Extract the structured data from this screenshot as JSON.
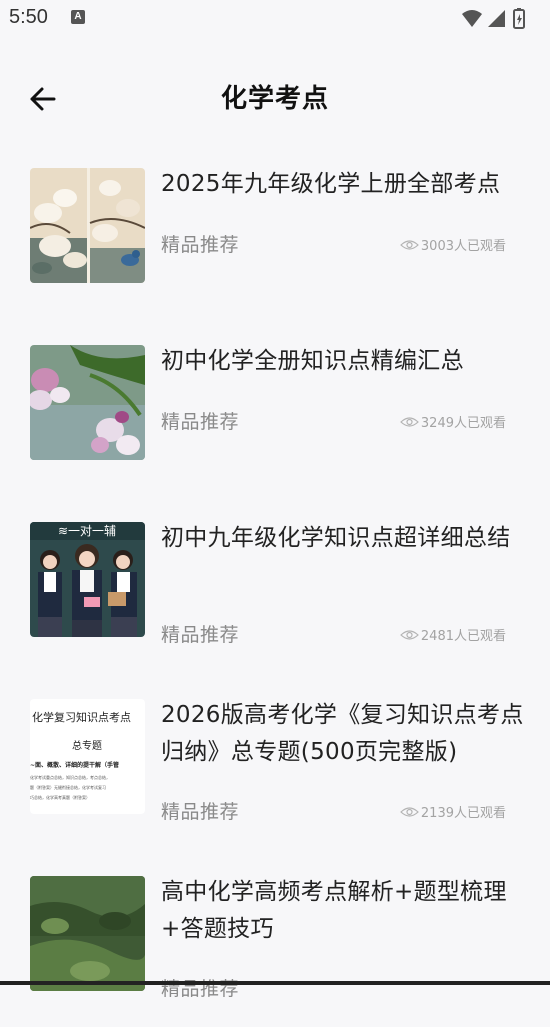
{
  "status_bar": {
    "time": "5:50",
    "a_icon_label": "A"
  },
  "header": {
    "title": "化学考点"
  },
  "items": [
    {
      "title": "2025年九年级化学上册全部考点",
      "tag": "精品推荐",
      "views": "3003人已观看",
      "thumb": "magnolia-bird-painting"
    },
    {
      "title": "初中化学全册知识点精编汇总",
      "tag": "精品推荐",
      "views": "3249人已观看",
      "thumb": "pink-flowers-photo"
    },
    {
      "title": "初中九年级化学知识点超详细总结",
      "tag": "精品推荐",
      "views": "2481人已观看",
      "thumb": "students-tutoring-photo",
      "thumb_caption": "≋一对一辅"
    },
    {
      "title": "2026版高考化学《复习知识点考点归纳》总专题(500页完整版)",
      "tag": "精品推荐",
      "views": "2139人已观看",
      "thumb": "document-preview",
      "thumb_lines": [
        "化学复习知识点考点",
        "总专题",
        "~面、概散、详细的提干解（手管",
        "化学考试重点总结，知识点总结，考点总结，",
        "题（附答案）无缝衔接总结，化学考试复习",
        "巧总结，化学高考真题（附答案）"
      ]
    },
    {
      "title": "高中化学高频考点解析+题型梳理+答题技巧",
      "tag": "精品推荐",
      "views": "",
      "thumb": "forest-photo"
    }
  ]
}
